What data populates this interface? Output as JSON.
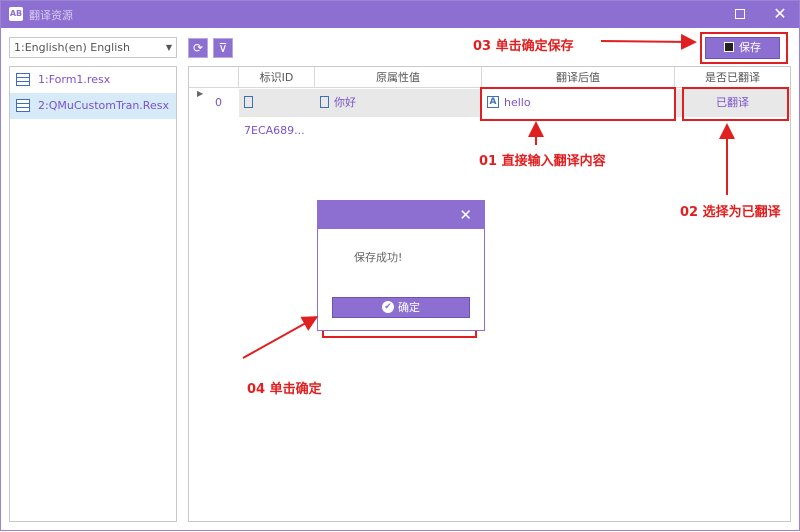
{
  "window": {
    "app_icon": "AB",
    "title": "翻译资源",
    "maximize_label": "",
    "close_label": "✕"
  },
  "language_select": {
    "value": "1:English(en) English"
  },
  "resources": [
    {
      "label": "1:Form1.resx"
    },
    {
      "label": "2:QMuCustomTran.Resx"
    }
  ],
  "toolbar": {
    "refresh_icon": "⟳",
    "filter_icon": "⊽",
    "save_label": "保存"
  },
  "grid": {
    "headers": [
      "标识ID",
      "原属性值",
      "翻译后值",
      "是否已翻译"
    ],
    "rows": [
      {
        "index": "0",
        "id": "7ECA689...",
        "original": "你好",
        "translated": "hello",
        "status": "已翻译"
      }
    ]
  },
  "dialog": {
    "close_label": "✕",
    "message": "保存成功!",
    "ok_label": "确定"
  },
  "annotations": {
    "step1": "01 直接输入翻译内容",
    "step2": "02 选择为已翻译",
    "step3": "03 单击确定保存",
    "step4": "04 单击确定"
  },
  "colors": {
    "accent": "#8d6fd1",
    "annotation": "#e02020"
  }
}
